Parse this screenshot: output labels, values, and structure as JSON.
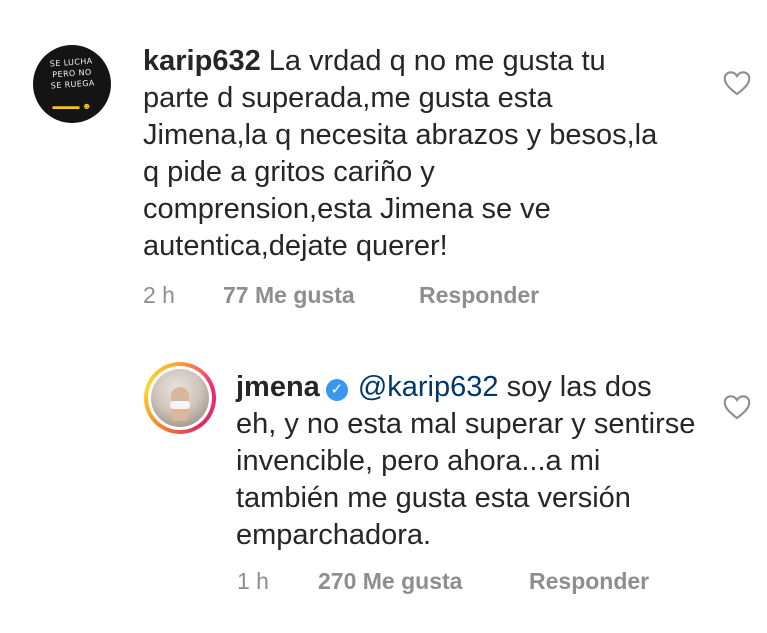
{
  "comments": [
    {
      "username": "karip632",
      "text": "La vrdad q no me gusta tu parte d superada,me gusta esta Jimena,la q necesita abrazos y besos,la q pide a gritos cariño y comprension,esta Jimena se ve autentica,dejate querer!",
      "time": "2 h",
      "likes": "77 Me gusta",
      "reply": "Responder",
      "avatar_text": "SE LUCHA PERO NO SE RUEGA",
      "like_icon": "heart-outline-icon"
    },
    {
      "username": "jmena",
      "verified": true,
      "mention": "@karip632",
      "text": "soy las dos eh, y no esta mal superar y sentirse invencible, pero ahora...a mi también me gusta esta versión emparchadora.",
      "time": "1 h",
      "likes": "270 Me gusta",
      "reply": "Responder",
      "like_icon": "heart-outline-icon"
    }
  ],
  "colors": {
    "text": "#262626",
    "meta": "#8e8e8e",
    "mention": "#00376b",
    "verified_badge": "#3897f0"
  }
}
